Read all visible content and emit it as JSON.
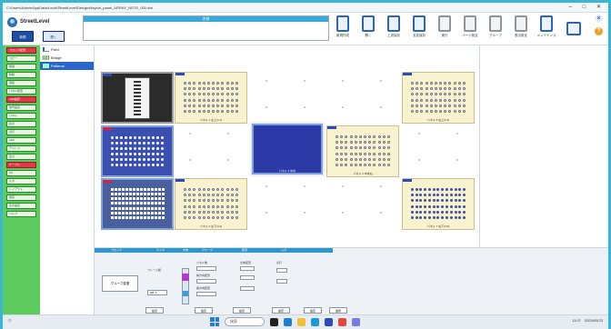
{
  "window": {
    "title": "C:\\Users\\Admin\\AppData\\Local\\StreetLevel\\Designs\\layout_panel_ARRAY_NOTE_000.dat",
    "controls": "–  □  ✕"
  },
  "app": {
    "name": "StreetLevel"
  },
  "toolbar": {
    "sub_buttons": [
      "新規",
      "開く"
    ],
    "title_field_label": "名前",
    "buttons": [
      {
        "label": "新規作成",
        "icon": "new-doc-icon",
        "enabled": true
      },
      {
        "label": "開く",
        "icon": "folder-icon",
        "enabled": true
      },
      {
        "label": "上書保存",
        "icon": "save-icon",
        "enabled": true
      },
      {
        "label": "名前保存",
        "icon": "save-as-icon",
        "enabled": true
      },
      {
        "label": "実行",
        "icon": "run-icon",
        "enabled": false
      },
      {
        "label": "ページ設定",
        "icon": "page-icon",
        "enabled": false
      },
      {
        "label": "グループ",
        "icon": "group-icon",
        "enabled": false
      },
      {
        "label": "表示設定",
        "icon": "display-icon",
        "enabled": false
      },
      {
        "label": "メンテナンス",
        "icon": "tools-icon",
        "enabled": true
      }
    ]
  },
  "sidebar": {
    "items": [
      "ブロック配置",
      "コピー",
      "削除",
      "移動",
      "回転",
      "パネル配置",
      "LED設定",
      "信号設定",
      "パネル",
      "表示",
      "点灯",
      "LED",
      "アドレス",
      "出力",
      "ケーブル",
      "PC",
      "入力",
      "レイアウト",
      "保存",
      "表示設定",
      "ヘルプ"
    ]
  },
  "tree": {
    "nodes": [
      "Field",
      "Bridge",
      "Patterns"
    ]
  },
  "tiles": [
    {
      "cap": "",
      "type": "grey"
    },
    {
      "cap": "パネル 1 左上(1,1)",
      "type": "yellow"
    },
    {
      "cap": "パネル 5 右上(1,5)",
      "type": "yellow"
    },
    {
      "cap": "",
      "type": "blue"
    },
    {
      "cap": "パネル 3 中央",
      "type": "plain"
    },
    {
      "cap": "パネル 4 中央右",
      "type": "yellow"
    },
    {
      "cap": "",
      "type": "bluesq"
    },
    {
      "cap": "パネル 6 左下(3,2)",
      "type": "yellow"
    },
    {
      "cap": "パネル 7 右下(3,5)",
      "type": "dense"
    }
  ],
  "bottom": {
    "headers": [
      "ブロック",
      "サイズ",
      "方向",
      "グループ",
      "配置",
      "入力"
    ],
    "left_button": "グループ変更",
    "size_label": "フレーム幅",
    "size_value": "WT 1",
    "labels": [
      "パネル数",
      "横方向配置",
      "縦方向配置",
      "全体配置",
      "点灯"
    ],
    "buttons": [
      "設定",
      "設定",
      "設定",
      "設定",
      "設定",
      "適用"
    ]
  },
  "taskbar": {
    "search": "検索",
    "time": "11:07",
    "date": "2024/05/23"
  }
}
